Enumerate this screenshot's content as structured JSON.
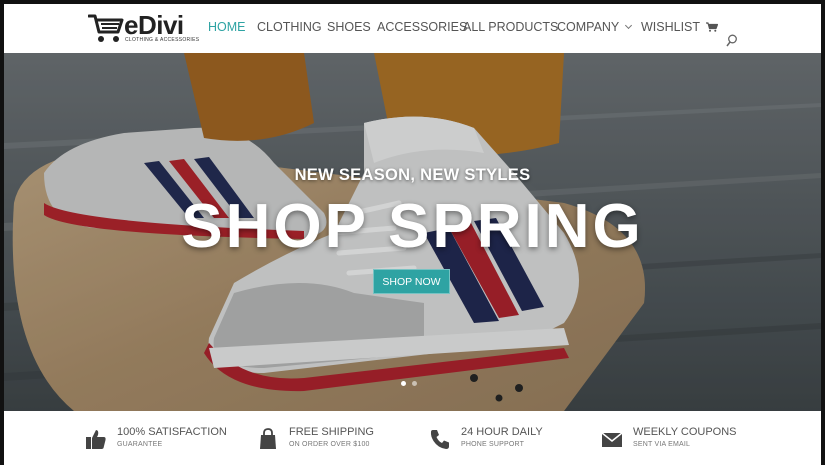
{
  "logo": {
    "name": "eDivi",
    "tagline": "CLOTHING & ACCESSORIES"
  },
  "nav": {
    "items": [
      {
        "label": "HOME",
        "active": true
      },
      {
        "label": "CLOTHING"
      },
      {
        "label": "SHOES"
      },
      {
        "label": "ACCESSORIES"
      },
      {
        "label": "ALL PRODUCTS"
      },
      {
        "label": "COMPANY"
      },
      {
        "label": "WISHLIST"
      }
    ],
    "icons": [
      "cart-icon",
      "search-icon"
    ]
  },
  "hero": {
    "subtitle": "NEW SEASON, NEW STYLES",
    "title": "SHOP SPRING",
    "button": "SHOP NOW",
    "slides": 2,
    "active_slide": 1
  },
  "features": [
    {
      "icon": "thumbs-up-icon",
      "title": "100% SATISFACTION",
      "subtitle": "GUARANTEE"
    },
    {
      "icon": "shopping-bag-icon",
      "title": "FREE SHIPPING",
      "subtitle": "ON ORDER OVER $100"
    },
    {
      "icon": "phone-icon",
      "title": "24 HOUR DAILY",
      "subtitle": "PHONE SUPPORT"
    },
    {
      "icon": "envelope-icon",
      "title": "WEEKLY COUPONS",
      "subtitle": "SENT VIA EMAIL"
    }
  ],
  "colors": {
    "accent": "#2ea3a3",
    "text": "#555555",
    "hero_text": "#ffffff"
  }
}
